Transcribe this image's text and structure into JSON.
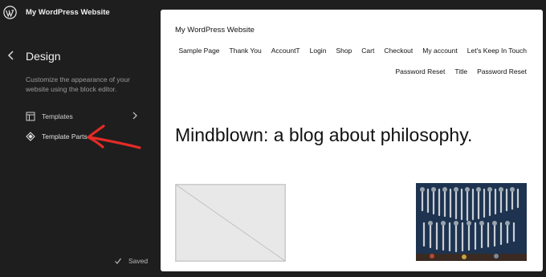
{
  "header": {
    "site_title": "My WordPress Website"
  },
  "sidebar": {
    "title": "Design",
    "description": "Customize the appearance of your website using the block editor.",
    "items": [
      {
        "label": "Templates",
        "icon": "layout-icon",
        "has_chevron": true
      },
      {
        "label": "Template Parts",
        "icon": "symbol-icon",
        "has_chevron": false
      }
    ],
    "status": "Saved"
  },
  "preview": {
    "site_title": "My WordPress Website",
    "menu_row1": [
      "Sample Page",
      "Thank You",
      "AccountT",
      "Login",
      "Shop",
      "Cart",
      "Checkout",
      "My account",
      "Let's Keep In Touch"
    ],
    "menu_row2": [
      "Password Reset",
      "Title",
      "Password Reset"
    ],
    "headline": "Mindblown: a blog about philosophy."
  }
}
